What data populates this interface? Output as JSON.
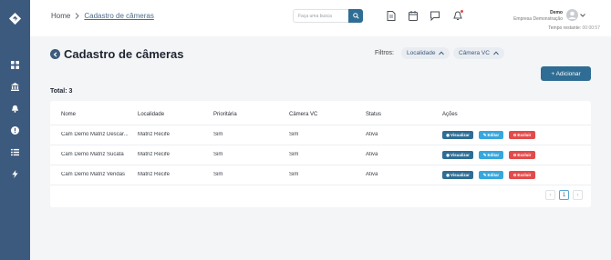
{
  "header": {
    "breadcrumb": [
      "Home",
      "Cadastro de câmeras"
    ],
    "search_placeholder": "Faça uma busca",
    "user": {
      "name": "Demo",
      "company": "Empresa Demonstração"
    },
    "timer": {
      "label": "Tempo restante:",
      "value": "00:00:57"
    }
  },
  "page": {
    "title": "Cadastro de câmeras",
    "filters_label": "Filtros:",
    "filters": [
      "Localidade",
      "Câmera VC"
    ],
    "add_label": "+ Adicionar",
    "total": "Total: 3"
  },
  "table": {
    "columns": [
      "Nome",
      "Localidade",
      "Prioritária",
      "Câmera VC",
      "Status",
      "Ações"
    ],
    "rows": [
      [
        "Cam Demo Matriz Descar...",
        "Matriz Recife",
        "Sim",
        "Sim",
        "Ativa"
      ],
      [
        "Cam Demo Matriz Sucata",
        "Matriz Recife",
        "Sim",
        "Sim",
        "Ativa"
      ],
      [
        "Cam Demo Matriz Vendas",
        "Matriz Recife",
        "Sim",
        "Sim",
        "Ativa"
      ]
    ],
    "actions": {
      "view": "Visualizar",
      "edit": "Editar",
      "delete": "Excluir"
    }
  },
  "pagination": {
    "prev": "‹",
    "current": "1",
    "next": "›"
  },
  "colors": {
    "sidebar": "#3c5a7d",
    "primary": "#2f6d94",
    "edit": "#37a7dc",
    "delete": "#e24b4b"
  },
  "icons": {
    "sidebar": [
      "dashboard-icon",
      "bank-icon",
      "bell-icon",
      "alert-icon",
      "list-icon",
      "bolt-icon"
    ],
    "topbar": [
      "document-icon",
      "calendar-icon",
      "chat-icon",
      "notification-bell-icon"
    ]
  }
}
